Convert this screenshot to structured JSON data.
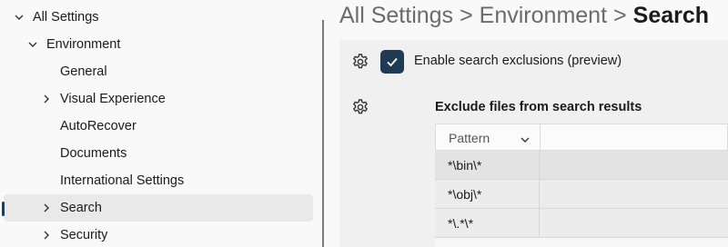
{
  "sidebar": {
    "items": [
      {
        "label": "All Settings",
        "chevron": "chevron-down-icon"
      },
      {
        "label": "Environment",
        "chevron": "chevron-down-icon"
      },
      {
        "label": "General",
        "chevron": ""
      },
      {
        "label": "Visual Experience",
        "chevron": "chevron-right-icon"
      },
      {
        "label": "AutoRecover",
        "chevron": ""
      },
      {
        "label": "Documents",
        "chevron": ""
      },
      {
        "label": "International Settings",
        "chevron": ""
      },
      {
        "label": "Search",
        "chevron": "chevron-right-icon",
        "selected": true
      },
      {
        "label": "Security",
        "chevron": "chevron-right-icon"
      }
    ]
  },
  "breadcrumb": {
    "parts": [
      "All Settings",
      "Environment"
    ],
    "separator": ">",
    "current": "Search"
  },
  "settings": {
    "enable_exclusions": {
      "label": "Enable search exclusions (preview)",
      "checked": true,
      "icon": "gear-icon"
    },
    "exclude_files": {
      "label": "Exclude files from search results",
      "icon": "gear-icon",
      "grid": {
        "columns": [
          "Pattern"
        ],
        "rows": [
          "*\\bin\\*",
          "*\\obj\\*",
          "*\\.*\\*"
        ]
      }
    }
  },
  "colors": {
    "accent": "#1f3a55",
    "selection_background": "#e9e9e9",
    "panel_background": "#f0f0f0"
  }
}
